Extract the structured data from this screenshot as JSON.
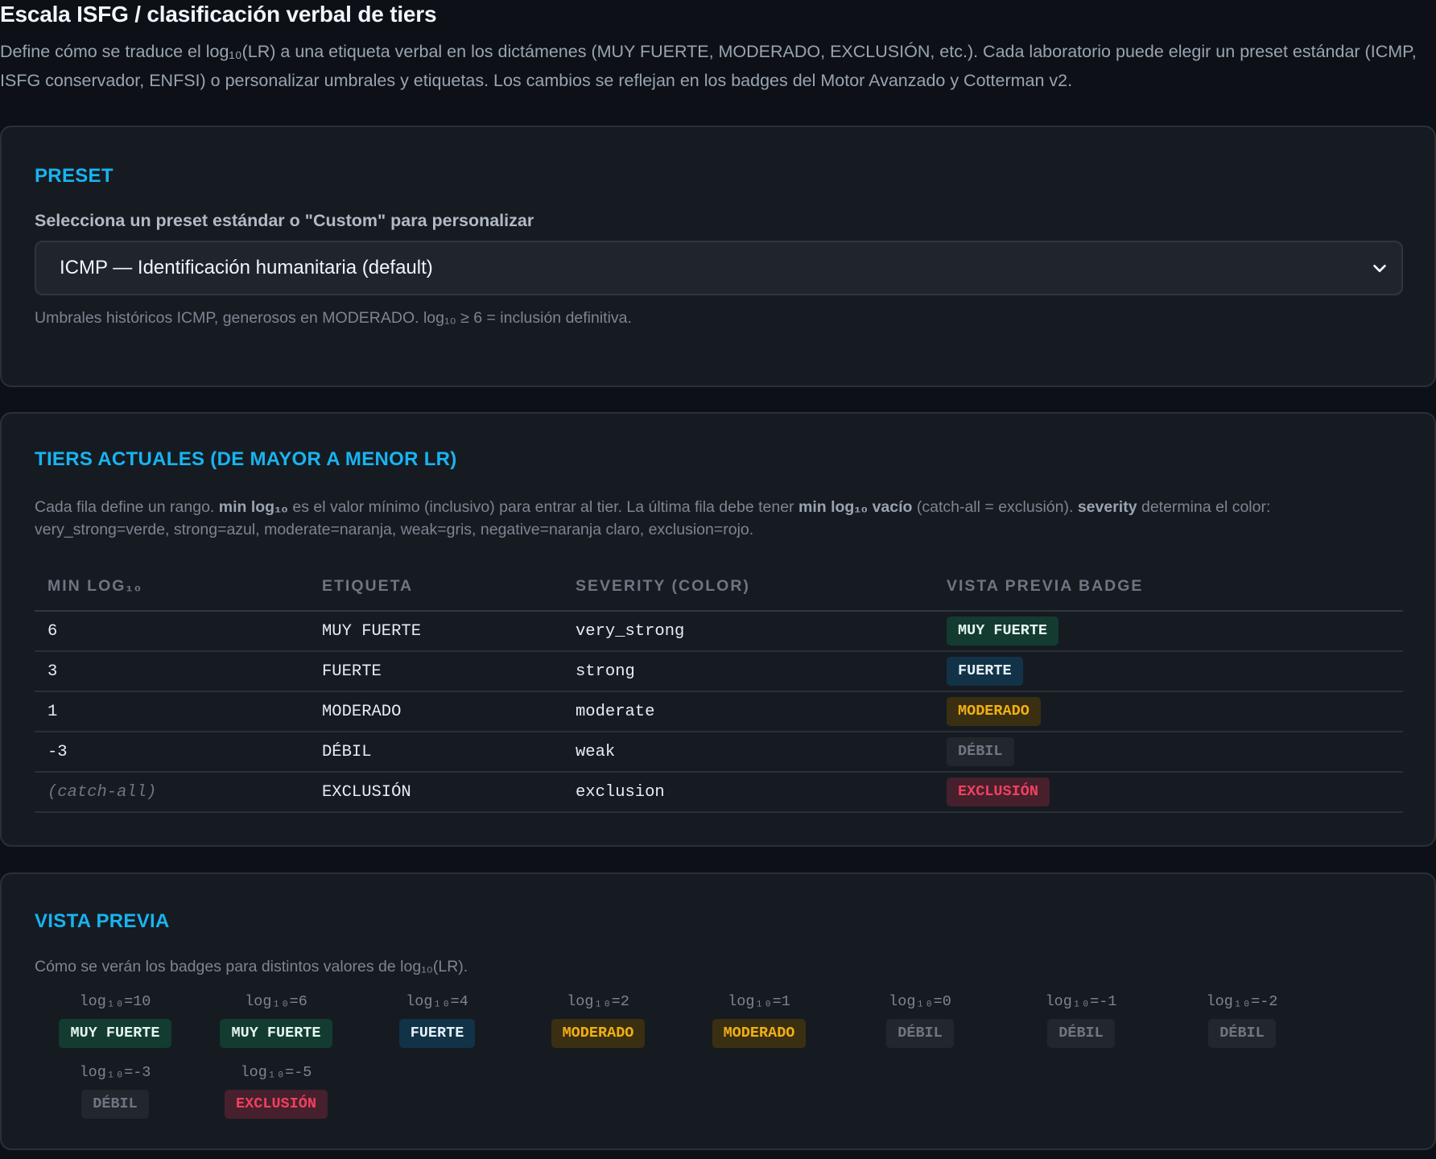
{
  "header": {
    "title": "Escala ISFG / clasificación verbal de tiers",
    "description": "Define cómo se traduce el log₁₀(LR) a una etiqueta verbal en los dictámenes (MUY FUERTE, MODERADO, EXCLUSIÓN, etc.). Cada laboratorio puede elegir un preset estándar (ICMP, ISFG conservador, ENFSI) o personalizar umbrales y etiquetas. Los cambios se reflejan en los badges del Motor Avanzado y Cotterman v2."
  },
  "preset": {
    "title": "PRESET",
    "label": "Selecciona un preset estándar o \"Custom\" para personalizar",
    "selected": "ICMP — Identificación humanitaria (default)",
    "hint": "Umbrales históricos ICMP, generosos en MODERADO. log₁₀ ≥ 6 = inclusión definitiva."
  },
  "tiers": {
    "title": "TIERS ACTUALES (DE MAYOR A MENOR LR)",
    "desc": {
      "p1": "Cada fila define un rango. ",
      "b1": "min log₁₀",
      "p2": " es el valor mínimo (inclusivo) para entrar al tier. La última fila debe tener ",
      "b2": "min log₁₀ vacío",
      "p3": " (catch-all = exclusión). ",
      "b3": "severity",
      "p4": " determina el color: very_strong=verde, strong=azul, moderate=naranja, weak=gris, negative=naranja claro, exclusion=rojo."
    },
    "columns": [
      "MIN LOG₁₀",
      "ETIQUETA",
      "SEVERITY (COLOR)",
      "VISTA PREVIA BADGE"
    ],
    "rows": [
      {
        "min": "6",
        "label": "MUY FUERTE",
        "severity": "very_strong",
        "badge": "MUY FUERTE"
      },
      {
        "min": "3",
        "label": "FUERTE",
        "severity": "strong",
        "badge": "FUERTE"
      },
      {
        "min": "1",
        "label": "MODERADO",
        "severity": "moderate",
        "badge": "MODERADO"
      },
      {
        "min": "-3",
        "label": "DÉBIL",
        "severity": "weak",
        "badge": "DÉBIL"
      },
      {
        "min": "(catch-all)",
        "label": "EXCLUSIÓN",
        "severity": "exclusion",
        "badge": "EXCLUSIÓN"
      }
    ]
  },
  "preview": {
    "title": "VISTA PREVIA",
    "desc": "Cómo se verán los badges para distintos valores de log₁₀(LR).",
    "items": [
      {
        "caption": "log₁₀=10",
        "badge": "MUY FUERTE",
        "severity": "very_strong"
      },
      {
        "caption": "log₁₀=6",
        "badge": "MUY FUERTE",
        "severity": "very_strong"
      },
      {
        "caption": "log₁₀=4",
        "badge": "FUERTE",
        "severity": "strong"
      },
      {
        "caption": "log₁₀=2",
        "badge": "MODERADO",
        "severity": "moderate"
      },
      {
        "caption": "log₁₀=1",
        "badge": "MODERADO",
        "severity": "moderate"
      },
      {
        "caption": "log₁₀=0",
        "badge": "DÉBIL",
        "severity": "weak"
      },
      {
        "caption": "log₁₀=-1",
        "badge": "DÉBIL",
        "severity": "weak"
      },
      {
        "caption": "log₁₀=-2",
        "badge": "DÉBIL",
        "severity": "weak"
      },
      {
        "caption": "log₁₀=-3",
        "badge": "DÉBIL",
        "severity": "weak"
      },
      {
        "caption": "log₁₀=-5",
        "badge": "EXCLUSIÓN",
        "severity": "exclusion"
      }
    ]
  },
  "colors": {
    "accent": "#18b4f0",
    "very_strong": "#133b30",
    "strong": "#123247",
    "moderate": "#f1b012",
    "weak": "#6e7681",
    "exclusion": "#f0405f"
  }
}
